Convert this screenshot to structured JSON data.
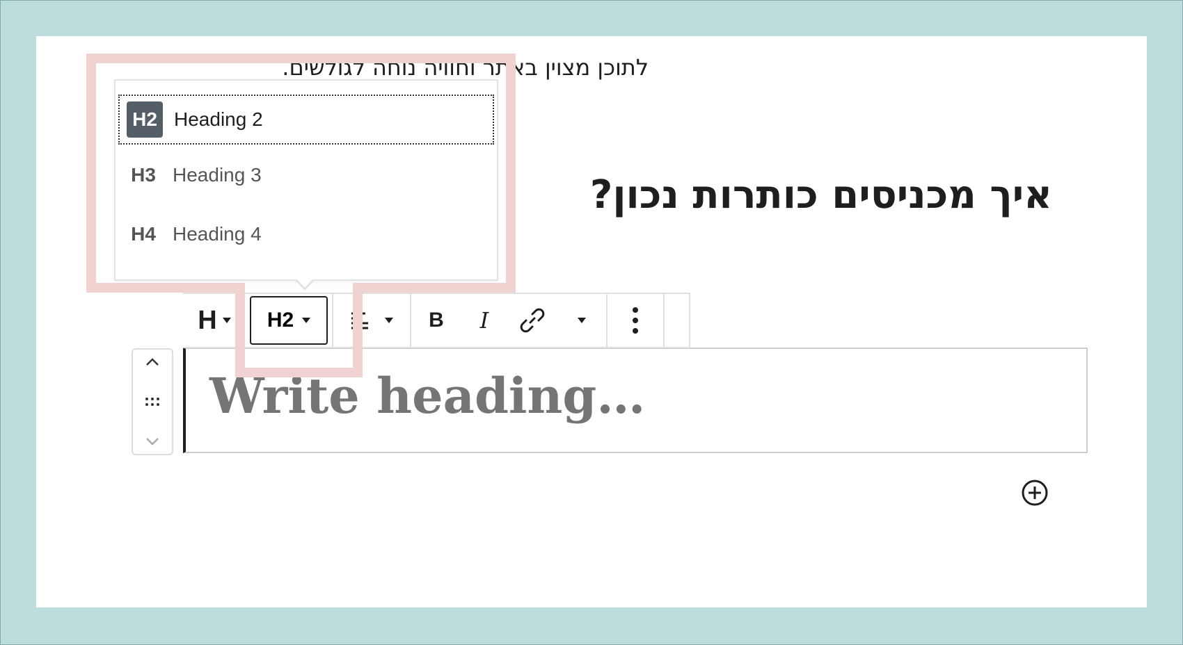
{
  "content": {
    "paragraph": "לתוכן מצוין באתר וחוויה נוחה לגולשים.",
    "heading_rtl": "איך מכניסים כותרות נכון?",
    "heading_placeholder": "Write heading…"
  },
  "toolbar": {
    "block_type_label": "H",
    "heading_level": "H2",
    "bold_label": "B",
    "italic_label": "I"
  },
  "dropdown": {
    "items": [
      {
        "badge": "H2",
        "label": "Heading 2",
        "selected": true
      },
      {
        "badge": "H3",
        "label": "Heading 3",
        "selected": false
      },
      {
        "badge": "H4",
        "label": "Heading 4",
        "selected": false
      }
    ]
  },
  "colors": {
    "frame_bg": "#bddcdc",
    "highlight": "#f0d3d0",
    "active_badge": "#555d66"
  }
}
